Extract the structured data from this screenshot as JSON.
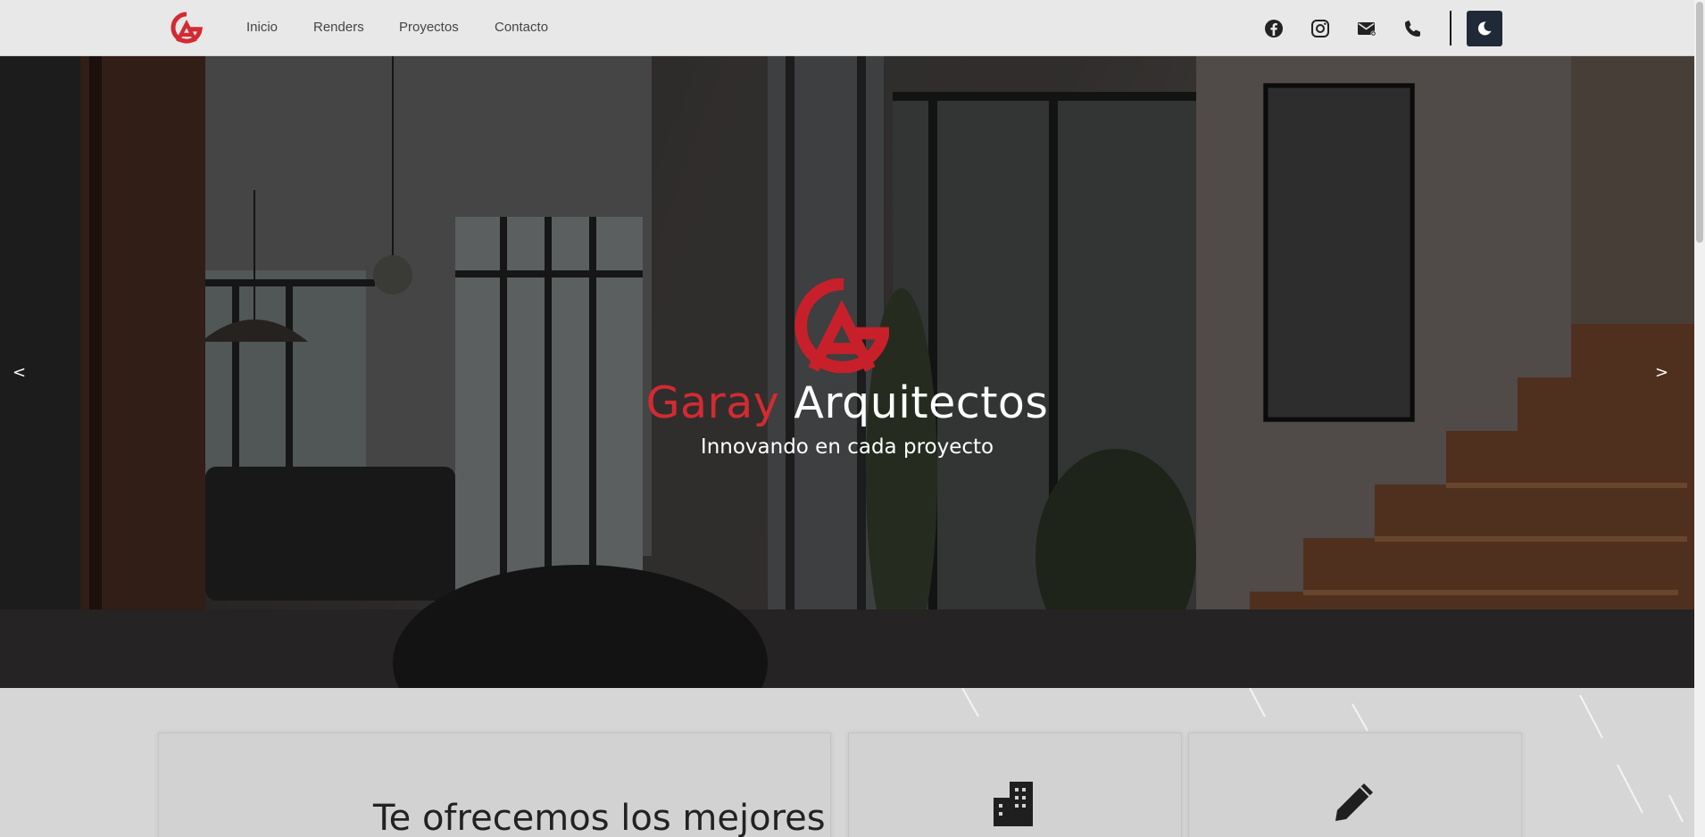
{
  "nav": {
    "links": [
      {
        "label": "Inicio"
      },
      {
        "label": "Renders"
      },
      {
        "label": "Proyectos"
      },
      {
        "label": "Contacto"
      }
    ],
    "icons": [
      "facebook-icon",
      "instagram-icon",
      "email-icon",
      "phone-icon"
    ],
    "theme_toggle_icon": "moon-icon"
  },
  "hero": {
    "title_accent": "Garay",
    "title_rest": "Arquitectos",
    "subtitle": "Innovando en cada proyecto",
    "prev_label": "<",
    "next_label": ">"
  },
  "services": {
    "heading": "Te ofrecemos los mejores",
    "card_icons": [
      "building-icon",
      "pencil-icon"
    ]
  },
  "colors": {
    "brand_red": "#d42a32",
    "navbar_bg": "#e8e8e8",
    "theme_button_bg": "#1f2937"
  }
}
